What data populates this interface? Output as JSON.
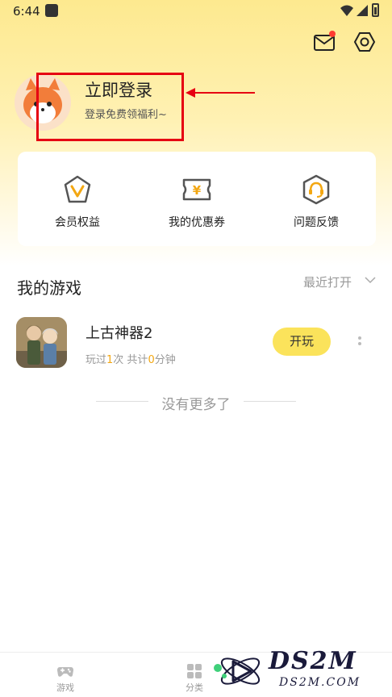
{
  "status_bar": {
    "time": "6:44"
  },
  "profile": {
    "login_title": "立即登录",
    "login_subtitle": "登录免费领福利~"
  },
  "quick_actions": [
    {
      "label": "会员权益",
      "icon": "vip-v-icon"
    },
    {
      "label": "我的优惠券",
      "icon": "coupon-icon"
    },
    {
      "label": "问题反馈",
      "icon": "headset-icon"
    }
  ],
  "my_games": {
    "title": "我的游戏",
    "sort_label": "最近打开",
    "games": [
      {
        "name": "上古神器2",
        "stats_prefix": "玩过",
        "play_count": "1",
        "stats_middle": "次 共计",
        "minutes": "0",
        "stats_suffix": "分钟",
        "play_label": "开玩"
      }
    ],
    "end_text": "没有更多了"
  },
  "bottom_nav": [
    {
      "label": "游戏",
      "icon": "gamepad-icon"
    },
    {
      "label": "分类",
      "icon": "grid-icon"
    }
  ],
  "watermark": {
    "text": "DS2M",
    "sub": "DS2M.COM"
  },
  "colors": {
    "accent_yellow": "#fbe35b",
    "highlight_red": "#e60012",
    "icon_orange": "#f3a712",
    "notification_red": "#ff3b30"
  }
}
